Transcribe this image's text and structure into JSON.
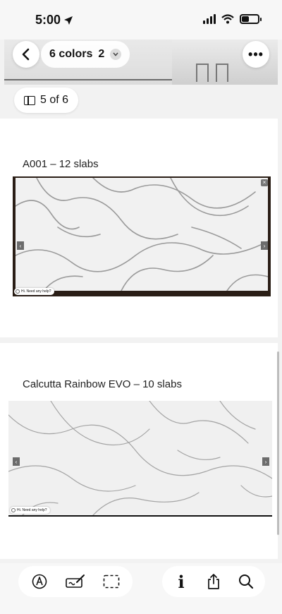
{
  "status_bar": {
    "time": "5:00",
    "location_icon": "location-arrow-icon",
    "signal_icon": "cellular-signal-icon",
    "wifi_icon": "wifi-icon",
    "battery_icon": "battery-icon"
  },
  "nav": {
    "back_icon": "chevron-left-icon",
    "title": "6 colors",
    "count": "2",
    "dropdown_icon": "chevron-down-icon",
    "more_icon": "ellipsis-icon",
    "more_label": "•••"
  },
  "page_indicator": {
    "icon": "sidebar-panel-icon",
    "label": "5 of 6"
  },
  "pages": [
    {
      "caption": "A001 – 12 slabs",
      "help_text": "Hi. Need any help?",
      "close_label": "×",
      "prev_label": "‹",
      "next_label": "›"
    },
    {
      "caption": "Calcutta Rainbow EVO – 10 slabs",
      "help_text": "Hi. Need any help?",
      "prev_label": "‹",
      "next_label": "›"
    }
  ],
  "toolbar": {
    "left": [
      "markup-pen-icon",
      "signature-icon",
      "selection-icon"
    ],
    "right": [
      "info-icon",
      "share-icon",
      "search-icon"
    ],
    "info_label": "i"
  },
  "colors": {
    "background": "#f2f2f2",
    "page": "#ffffff",
    "veins": "#9a9a9a"
  }
}
